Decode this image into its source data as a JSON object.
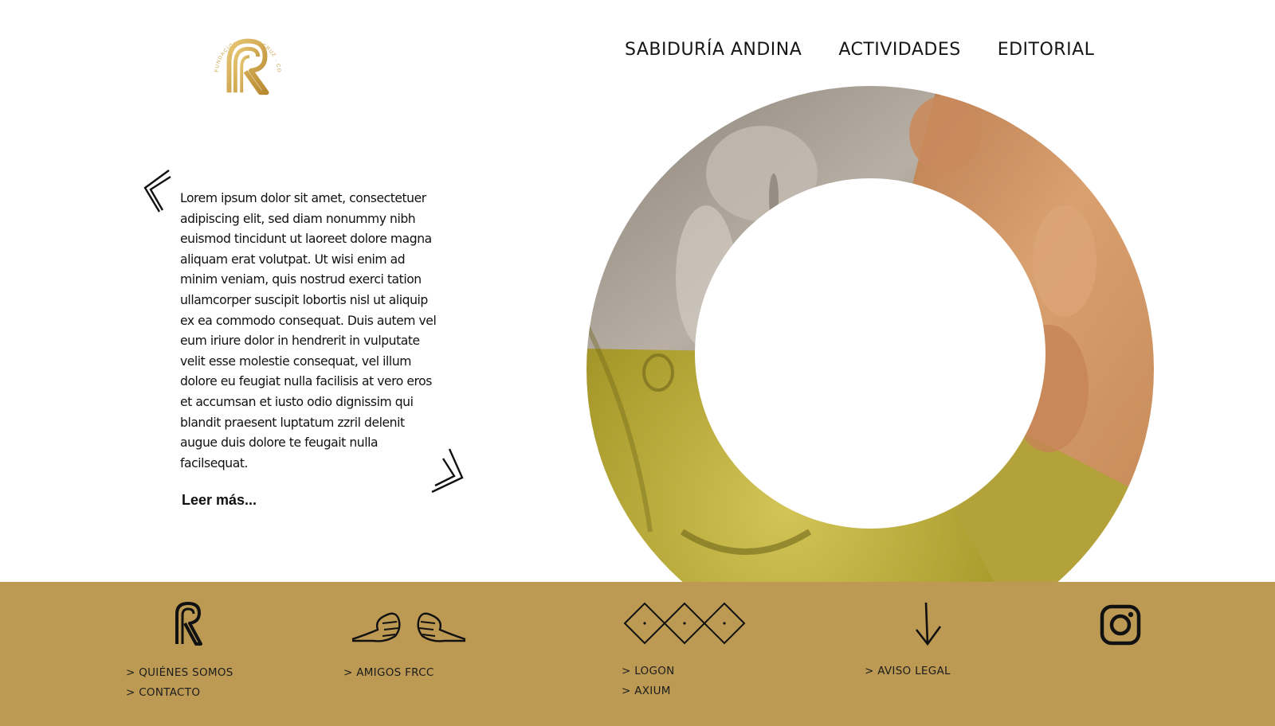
{
  "header": {
    "logo_text": "FUNDACIÓN · ROSACRUZ · COLOMBIA",
    "nav": [
      "SABIDURÍA ANDINA",
      "ACTIVIDADES",
      "EDITORIAL"
    ]
  },
  "intro": {
    "text": "Lorem ipsum dolor sit amet, consectetuer adipiscing elit, sed diam nonummy nibh euismod tincidunt ut laoreet dolore magna aliquam erat volutpat. Ut wisi enim ad minim veniam, quis nostrud exerci tation ullamcorper suscipit lobortis nisl ut aliquip ex ea commodo consequat. Duis autem vel eum iriure dolor in hendrerit in vulputate velit esse molestie consequat, vel illum dolore eu feugiat nulla facilisis at vero eros et accumsan et iusto odio dignissim qui blandit praesent luptatum zzril delenit augue duis dolore te feugait nulla facilsequat.",
    "read_more": "Leer más..."
  },
  "footer": {
    "col1": [
      "> QUIÉNES SOMOS",
      "> CONTACTO"
    ],
    "col2": [
      "> AMIGOS FRCC"
    ],
    "col3": [
      "> LOGON",
      "> AXIUM"
    ],
    "col4": [
      "> AVISO LEGAL"
    ]
  },
  "colors": {
    "footer_bg": "#bc9a54",
    "gold": "#c9a24a",
    "stone": "#9d948a",
    "clay": "#c98a5c",
    "bronze": "#a99a2c"
  },
  "icons": [
    "rk-logo-icon",
    "chevron-left-icon",
    "chevron-right-icon",
    "rk-monogram-icon",
    "hands-icon",
    "diamonds-icon",
    "arrow-down-icon",
    "instagram-icon"
  ]
}
